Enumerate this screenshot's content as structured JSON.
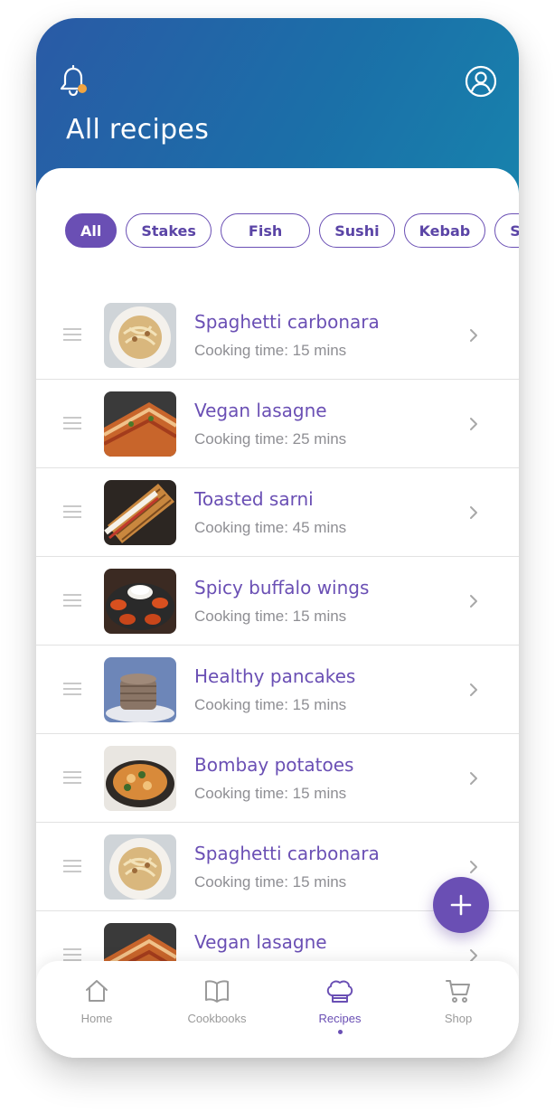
{
  "header": {
    "title": "All recipes"
  },
  "filters": {
    "chips": [
      {
        "label": "All",
        "active": true
      },
      {
        "label": "Stakes",
        "active": false
      },
      {
        "label": "Fish",
        "active": false
      },
      {
        "label": "Sushi",
        "active": false
      },
      {
        "label": "Kebab",
        "active": false
      },
      {
        "label": "Salads",
        "active": false
      }
    ]
  },
  "recipes": [
    {
      "title": "Spaghetti carbonara",
      "time": "Cooking time:  15 mins",
      "thumb": "pasta"
    },
    {
      "title": "Vegan lasagne",
      "time": "Cooking time:  25 mins",
      "thumb": "lasagne"
    },
    {
      "title": "Toasted sarni",
      "time": "Cooking time:  45 mins",
      "thumb": "sandwich"
    },
    {
      "title": "Spicy buffalo wings",
      "time": "Cooking time:  15 mins",
      "thumb": "wings"
    },
    {
      "title": "Healthy pancakes",
      "time": "Cooking time:  15 mins",
      "thumb": "pancakes"
    },
    {
      "title": "Bombay potatoes",
      "time": "Cooking time:  15 mins",
      "thumb": "curry"
    },
    {
      "title": "Spaghetti carbonara",
      "time": "Cooking time:  15 mins",
      "thumb": "pasta"
    },
    {
      "title": "Vegan lasagne",
      "time": "",
      "thumb": "lasagne"
    }
  ],
  "tabbar": {
    "home": "Home",
    "cookbooks": "Cookbooks",
    "recipes": "Recipes",
    "shop": "Shop"
  },
  "colors": {
    "accent": "#6a4fb4",
    "header_gradient_start": "#2a5aa6",
    "header_gradient_end": "#1784ad",
    "notification_dot": "#f2a541"
  },
  "icons": {
    "header_left": "bell-icon",
    "header_right": "user-profile-icon",
    "row_handle": "drag-handle-icon",
    "row_arrow": "chevron-right-icon",
    "fab": "plus-icon",
    "tabs": [
      "home-icon",
      "book-icon",
      "chef-hat-icon",
      "cart-icon"
    ]
  }
}
